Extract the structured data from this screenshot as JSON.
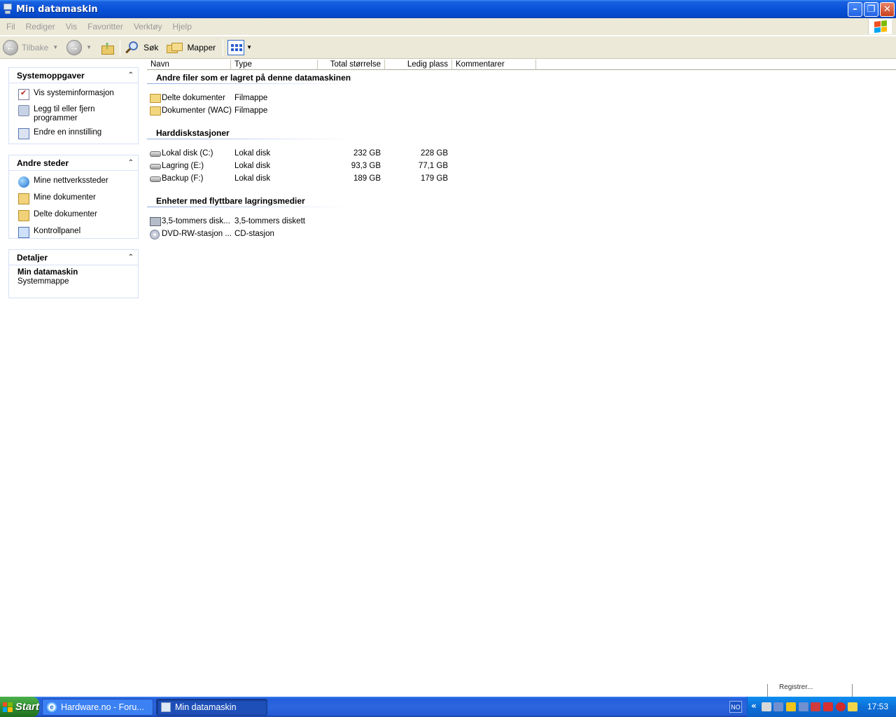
{
  "window": {
    "title": "Min datamaskin",
    "controls": {
      "minimize": "–",
      "maximize": "❐",
      "close": "✕"
    }
  },
  "menubar": {
    "items": [
      "Fil",
      "Rediger",
      "Vis",
      "Favoritter",
      "Verktøy",
      "Hjelp"
    ]
  },
  "toolbar": {
    "back_label": "Tilbake",
    "search_label": "Søk",
    "folders_label": "Mapper"
  },
  "sidebar": {
    "panels": [
      {
        "title": "Systemoppgaver",
        "items": [
          "Vis systeminformasjon",
          "Legg til eller fjern programmer",
          "Endre en innstilling"
        ]
      },
      {
        "title": "Andre steder",
        "items": [
          "Mine nettverkssteder",
          "Mine dokumenter",
          "Delte dokumenter",
          "Kontrollpanel"
        ]
      },
      {
        "title": "Detaljer",
        "name": "Min datamaskin",
        "subtitle": "Systemmappe"
      }
    ]
  },
  "columns": [
    "Navn",
    "Type",
    "Total størrelse",
    "Ledig plass",
    "Kommentarer"
  ],
  "groups": [
    {
      "title": "Andre filer som er lagret på denne datamaskinen",
      "items": [
        {
          "name": "Delte dokumenter",
          "type": "Filmappe",
          "total": "",
          "free": ""
        },
        {
          "name": "Dokumenter (WAC)",
          "type": "Filmappe",
          "total": "",
          "free": ""
        }
      ]
    },
    {
      "title": "Harddiskstasjoner",
      "items": [
        {
          "name": "Lokal disk (C:)",
          "type": "Lokal disk",
          "total": "232 GB",
          "free": "228 GB"
        },
        {
          "name": "Lagring (E:)",
          "type": "Lokal disk",
          "total": "93,3 GB",
          "free": "77,1 GB"
        },
        {
          "name": "Backup (F:)",
          "type": "Lokal disk",
          "total": "189 GB",
          "free": "179 GB"
        }
      ]
    },
    {
      "title": "Enheter med flyttbare lagringsmedier",
      "items": [
        {
          "name": "3,5-tommers disk...",
          "type": "3,5-tommers diskett",
          "total": "",
          "free": ""
        },
        {
          "name": "DVD-RW-stasjon ...",
          "type": "CD-stasjon",
          "total": "",
          "free": ""
        }
      ]
    }
  ],
  "taskbar": {
    "start_label": "Start",
    "tasks": [
      "Hardware.no - Foru...",
      "Min datamaskin"
    ],
    "language": "NO",
    "tray_expand": "«",
    "clock": "17:53",
    "popup_fragment": "Registrer..."
  },
  "colors": {
    "titlebar": "#0a52d8",
    "menubar_bg": "#ece9d8",
    "taskbar": "#245edb",
    "start_button": "#2e8a2e",
    "tray": "#0c6fd7"
  }
}
